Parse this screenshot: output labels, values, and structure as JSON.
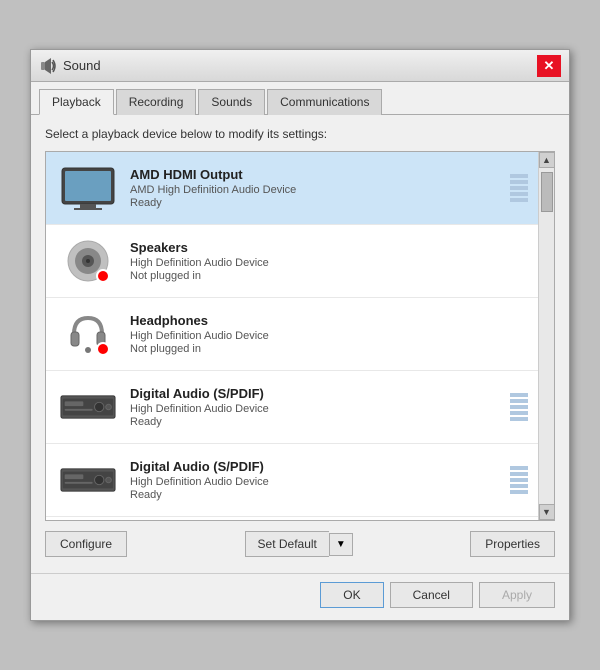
{
  "dialog": {
    "title": "Sound",
    "close_label": "✕"
  },
  "tabs": [
    {
      "id": "playback",
      "label": "Playback",
      "active": true
    },
    {
      "id": "recording",
      "label": "Recording",
      "active": false
    },
    {
      "id": "sounds",
      "label": "Sounds",
      "active": false
    },
    {
      "id": "communications",
      "label": "Communications",
      "active": false
    }
  ],
  "instruction": "Select a playback device below to modify its settings:",
  "devices": [
    {
      "name": "AMD HDMI Output",
      "sub": "AMD High Definition Audio Device",
      "status": "Ready",
      "icon_type": "tv",
      "selected": true,
      "show_bars": true
    },
    {
      "name": "Speakers",
      "sub": "High Definition Audio Device",
      "status": "Not plugged in",
      "icon_type": "speaker",
      "selected": false,
      "show_bars": false,
      "show_red_dot": true
    },
    {
      "name": "Headphones",
      "sub": "High Definition Audio Device",
      "status": "Not plugged in",
      "icon_type": "headphone",
      "selected": false,
      "show_bars": false,
      "show_red_dot": true
    },
    {
      "name": "Digital Audio (S/PDIF)",
      "sub": "High Definition Audio Device",
      "status": "Ready",
      "icon_type": "audio_device",
      "selected": false,
      "show_bars": true
    },
    {
      "name": "Digital Audio (S/PDIF)",
      "sub": "High Definition Audio Device",
      "status": "Ready",
      "icon_type": "audio_device",
      "selected": false,
      "show_bars": true
    }
  ],
  "buttons": {
    "configure": "Configure",
    "set_default": "Set Default",
    "properties": "Properties",
    "ok": "OK",
    "cancel": "Cancel",
    "apply": "Apply"
  }
}
